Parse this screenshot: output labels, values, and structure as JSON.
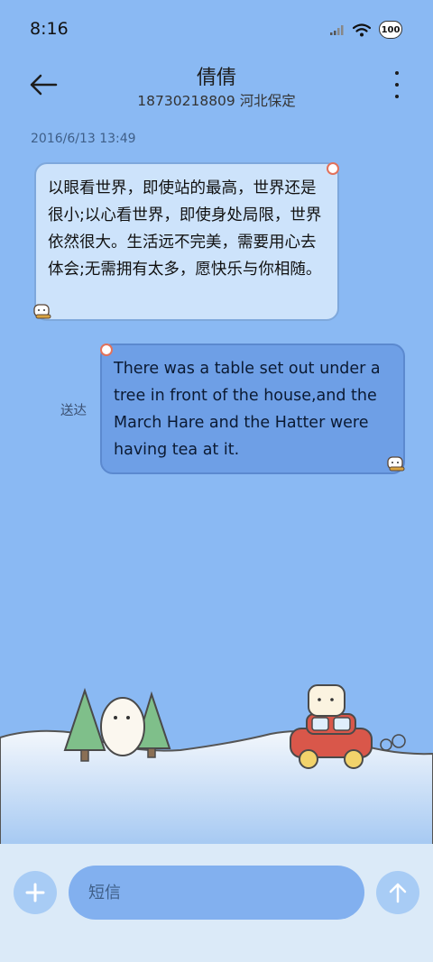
{
  "status_bar": {
    "time": "8:16",
    "battery_level": "100"
  },
  "header": {
    "contact_name": "倩倩",
    "contact_subtitle": "18730218809 河北保定"
  },
  "conversation": {
    "timestamp": "2016/6/13 13:49",
    "messages": [
      {
        "direction": "incoming",
        "text": "以眼看世界，即使站的最高，世界还是很小;以心看世界，即使身处局限，世界依然很大。生活远不完美，需要用心去体会;无需拥有太多，愿快乐与你相随。"
      },
      {
        "direction": "outgoing",
        "text": "There was a table set out under a tree in front of the house,and the March Hare and the Hatter were having tea at it.",
        "status": "送达"
      }
    ]
  },
  "composer": {
    "placeholder": "短信"
  },
  "icons": {
    "back": "arrow-left-icon",
    "more": "more-vert-icon",
    "add": "plus-icon",
    "send": "arrow-up-icon",
    "signal": "signal-icon",
    "wifi": "wifi-icon",
    "battery": "battery-icon"
  },
  "colors": {
    "background": "#8ab9f3",
    "incoming_bubble": "#cde3fb",
    "outgoing_bubble": "#6e9fe6",
    "input_bar": "#dbeaf8"
  }
}
